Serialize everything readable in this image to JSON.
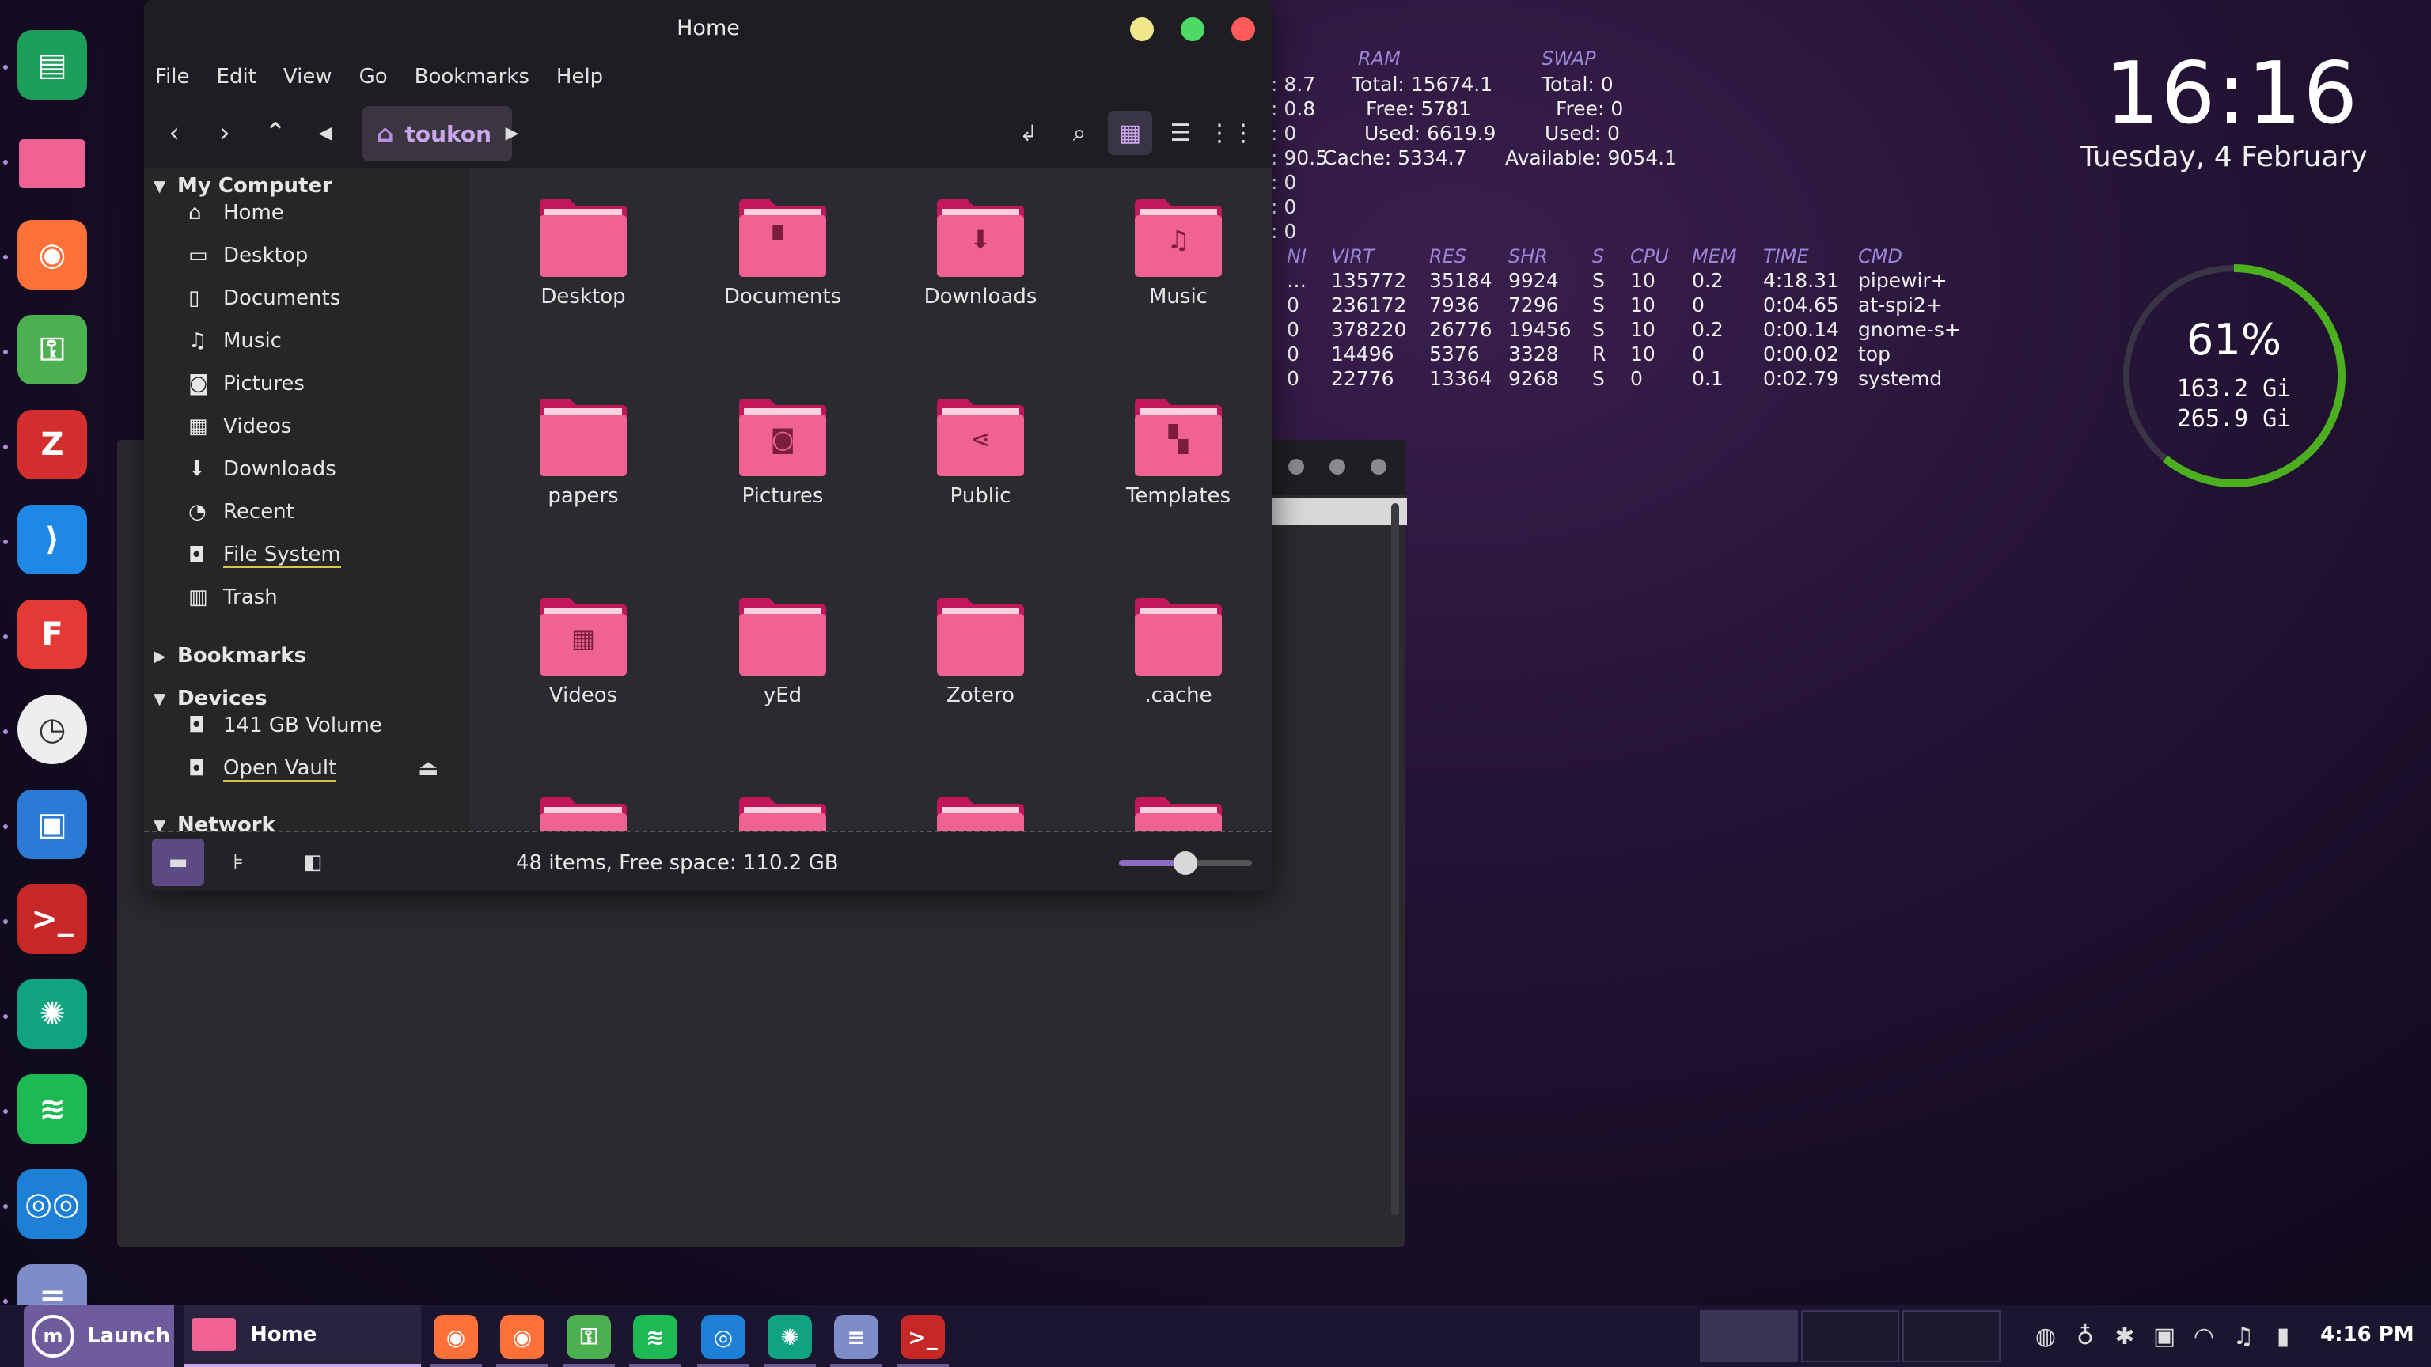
{
  "dock": {
    "apps": [
      {
        "name": "libreoffice-calc",
        "color": "#1d9e5b",
        "glyph": "▤"
      },
      {
        "name": "files",
        "color": "#f06292",
        "glyph": ""
      },
      {
        "name": "firefox",
        "color": "#ff7139",
        "glyph": "◉"
      },
      {
        "name": "passwords",
        "color": "#4caf50",
        "glyph": "⚿"
      },
      {
        "name": "zotero",
        "color": "#d32f2f",
        "glyph": "Z"
      },
      {
        "name": "vscode",
        "color": "#1e88e5",
        "glyph": "⟩"
      },
      {
        "name": "foliate",
        "color": "#e53935",
        "glyph": "F"
      },
      {
        "name": "clock",
        "color": "#eeeeee",
        "glyph": "◷"
      },
      {
        "name": "virtualbox",
        "color": "#2b7bd6",
        "glyph": "▣"
      },
      {
        "name": "terminal",
        "color": "#c62828",
        "glyph": ">_"
      },
      {
        "name": "chatgpt",
        "color": "#10a37f",
        "glyph": "✺"
      },
      {
        "name": "spotify",
        "color": "#1db954",
        "glyph": "≋"
      },
      {
        "name": "reader",
        "color": "#1e7fd6",
        "glyph": "◎◎"
      },
      {
        "name": "text-editor",
        "color": "#7e8cc8",
        "glyph": "≡"
      }
    ]
  },
  "fm": {
    "title": "Home",
    "menu": [
      "File",
      "Edit",
      "View",
      "Go",
      "Bookmarks",
      "Help"
    ],
    "crumb": "toukon",
    "sidebar": {
      "my_computer": "My Computer",
      "items": [
        {
          "label": "Home",
          "icon": "⌂"
        },
        {
          "label": "Desktop",
          "icon": "▭"
        },
        {
          "label": "Documents",
          "icon": "▯"
        },
        {
          "label": "Music",
          "icon": "♫"
        },
        {
          "label": "Pictures",
          "icon": "◙"
        },
        {
          "label": "Videos",
          "icon": "▦"
        },
        {
          "label": "Downloads",
          "icon": "⬇"
        },
        {
          "label": "Recent",
          "icon": "◔"
        },
        {
          "label": "File System",
          "icon": "◘"
        },
        {
          "label": "Trash",
          "icon": "▥"
        }
      ],
      "bookmarks": "Bookmarks",
      "devices": "Devices",
      "device_items": [
        {
          "label": "141 GB Volume",
          "icon": "◘"
        },
        {
          "label": "Open Vault",
          "icon": "◘"
        }
      ],
      "network": "Network"
    },
    "folders": [
      {
        "label": "Desktop",
        "glyph": ""
      },
      {
        "label": "Documents",
        "glyph": "▘"
      },
      {
        "label": "Downloads",
        "glyph": "⬇"
      },
      {
        "label": "Music",
        "glyph": "♫"
      },
      {
        "label": "papers",
        "glyph": ""
      },
      {
        "label": "Pictures",
        "glyph": "◙"
      },
      {
        "label": "Public",
        "glyph": "⋖"
      },
      {
        "label": "Templates",
        "glyph": "▚"
      },
      {
        "label": "Videos",
        "glyph": "▦"
      },
      {
        "label": "yEd",
        "glyph": ""
      },
      {
        "label": "Zotero",
        "glyph": ""
      },
      {
        "label": ".cache",
        "glyph": ""
      }
    ],
    "status": "48 items, Free space: 110.2 GB",
    "zoom_level": 0.5,
    "colors": {
      "folder": "#f06292",
      "folder_dark": "#c2185b",
      "accent": "#8c6bc2"
    }
  },
  "conky": {
    "cpu_vals": [
      ": 8.7",
      ": 0.8",
      ": 0",
      ": 90.5",
      ": 0",
      ": 0",
      ": 0"
    ],
    "ram_head": "RAM",
    "ram": [
      "Total: 15674.1",
      "Free: 5781",
      "Used: 6619.9",
      "Cache: 5334.7"
    ],
    "swap_head": "SWAP",
    "swap": [
      "Total: 0",
      "Free: 0",
      "Used: 0",
      "Available: 9054.1"
    ],
    "proc_headers": [
      "NI",
      "VIRT",
      "RES",
      "SHR",
      "S",
      "CPU",
      "MEM",
      "TIME",
      "CMD"
    ],
    "procs": [
      [
        "…",
        "135772",
        "35184",
        "9924",
        "S",
        "10",
        "0.2",
        "4:18.31",
        "pipewir+"
      ],
      [
        "0",
        "236172",
        "7936",
        "7296",
        "S",
        "10",
        "0",
        "0:04.65",
        "at-spi2+"
      ],
      [
        "0",
        "378220",
        "26776",
        "19456",
        "S",
        "10",
        "0.2",
        "0:00.14",
        "gnome-s+"
      ],
      [
        "0",
        "14496",
        "5376",
        "3328",
        "R",
        "10",
        "0",
        "0:00.02",
        "top"
      ],
      [
        "0",
        "22776",
        "13364",
        "9268",
        "S",
        "0",
        "0.1",
        "0:02.79",
        "systemd"
      ]
    ]
  },
  "clock": {
    "time": "16:16",
    "date": "Tuesday,  4 February",
    "disk_pct": "61%",
    "disk_fraction": 0.61,
    "used": "163.2 Gi",
    "total": "265.9 Gi"
  },
  "taskbar": {
    "launch": "Launch",
    "home": "Home",
    "apps": [
      {
        "name": "firefox-1",
        "color": "#ff7139",
        "glyph": "◉"
      },
      {
        "name": "firefox-2",
        "color": "#ff7139",
        "glyph": "◉"
      },
      {
        "name": "passwords",
        "color": "#4caf50",
        "glyph": "⚿"
      },
      {
        "name": "spotify",
        "color": "#1db954",
        "glyph": "≋"
      },
      {
        "name": "reader",
        "color": "#1e7fd6",
        "glyph": "◎"
      },
      {
        "name": "chatgpt",
        "color": "#10a37f",
        "glyph": "✺"
      },
      {
        "name": "text-editor",
        "color": "#7e8cc8",
        "glyph": "≡"
      },
      {
        "name": "terminal",
        "color": "#c62828",
        "glyph": ">_"
      }
    ],
    "tray": [
      "◍",
      "♁",
      "✱",
      "▣",
      "◠",
      "♫",
      "▮"
    ],
    "time": "4:16 PM"
  }
}
